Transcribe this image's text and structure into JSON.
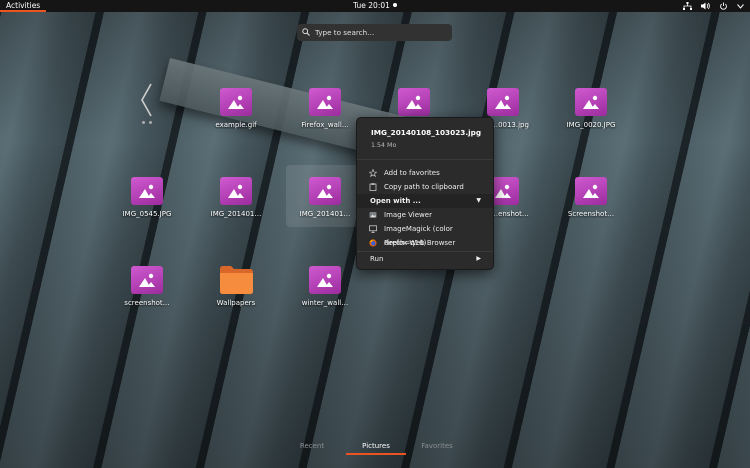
{
  "topbar": {
    "activities": "Activities",
    "clock": "Tue 20:01"
  },
  "search": {
    "placeholder": "Type to search…"
  },
  "files": [
    {
      "label": "example.gif",
      "type": "image"
    },
    {
      "label": "Firefox_wall…",
      "type": "image"
    },
    {
      "label": "",
      "type": "image"
    },
    {
      "label": "…0013.jpg",
      "type": "image"
    },
    {
      "label": "IMG_0020.JPG",
      "type": "image"
    },
    {
      "label": "IMG_0545.JPG",
      "type": "image"
    },
    {
      "label": "IMG_201401…",
      "type": "image"
    },
    {
      "label": "IMG_201401…",
      "type": "image"
    },
    {
      "label": "…enshot…",
      "type": "image"
    },
    {
      "label": "Screenshot…",
      "type": "image"
    },
    {
      "label": "screenshot…",
      "type": "image"
    },
    {
      "label": "Wallpapers",
      "type": "folder"
    },
    {
      "label": "winter_wall…",
      "type": "image"
    }
  ],
  "context_menu": {
    "filename": "IMG_20140108_103023.jpg",
    "filesize": "1.54 Mo",
    "add_favorites": "Add to favorites",
    "copy_path": "Copy path to clipboard",
    "open_with": "Open with ...",
    "apps": [
      "Image Viewer",
      "ImageMagick (color depth=q16)",
      "Firefox Web Browser"
    ],
    "run": "Run"
  },
  "tabs": [
    "Recent",
    "Pictures",
    "Favorites"
  ],
  "active_tab": "Pictures",
  "colors": {
    "accent": "#e95420",
    "image_icon": "#c14bc3",
    "folder_icon": "#f08a3c"
  }
}
